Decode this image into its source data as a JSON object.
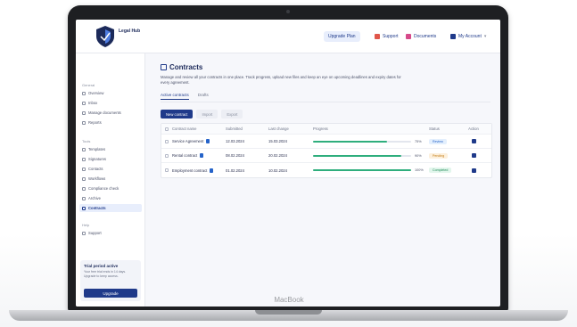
{
  "device": {
    "brand": "MacBook"
  },
  "app": {
    "logo_text": "Legal Hub"
  },
  "topbar": {
    "buttons": [
      {
        "label": "Upgrade Plan",
        "primary": true
      },
      {
        "label": "Support",
        "primary": false
      },
      {
        "label": "Documents",
        "primary": false
      },
      {
        "label": "My Account",
        "primary": false
      }
    ]
  },
  "sidebar": {
    "sections": [
      {
        "label": "General",
        "items": [
          {
            "label": "Overview",
            "active": false
          },
          {
            "label": "Inbox",
            "active": false
          },
          {
            "label": "Manage documents",
            "active": false
          },
          {
            "label": "Reports",
            "active": false
          }
        ]
      },
      {
        "label": "Tools",
        "items": [
          {
            "label": "Templates",
            "active": false
          },
          {
            "label": "Signatures",
            "active": false
          },
          {
            "label": "Contacts",
            "active": false
          },
          {
            "label": "Workflows",
            "active": false
          },
          {
            "label": "Compliance check",
            "active": false
          },
          {
            "label": "Archive",
            "active": false
          },
          {
            "label": "Contracts",
            "active": true
          }
        ]
      },
      {
        "label": "Help",
        "items": [
          {
            "label": "Support",
            "active": false
          }
        ]
      }
    ],
    "trial": {
      "title": "Trial period active",
      "subtitle": "Your free trial ends in 14 days. Upgrade to keep access.",
      "button": "Upgrade"
    }
  },
  "main": {
    "title": "Contracts",
    "description": "Manage and review all your contracts in one place. Track progress, upload new files and keep an eye on upcoming deadlines and expiry dates for every agreement.",
    "tabs": [
      {
        "label": "Active contracts",
        "active": true
      },
      {
        "label": "Drafts",
        "active": false
      }
    ],
    "actions": [
      {
        "label": "New contract",
        "primary": true
      },
      {
        "label": "Import",
        "primary": false
      },
      {
        "label": "Export",
        "primary": false
      }
    ],
    "table": {
      "headers": [
        "Contract name",
        "Submitted",
        "Last change",
        "Progress",
        "Status",
        "Action"
      ],
      "rows": [
        {
          "name": "Service Agreement",
          "submitted": "12.03.2024",
          "last": "15.03.2024",
          "progress": 0.75,
          "pct": "75%",
          "status": "Review",
          "status_color": "blue"
        },
        {
          "name": "Rental contract",
          "submitted": "08.02.2024",
          "last": "20.02.2024",
          "progress": 0.9,
          "pct": "90%",
          "status": "Pending",
          "status_color": "orange"
        },
        {
          "name": "Employment contract",
          "submitted": "01.02.2024",
          "last": "10.02.2024",
          "progress": 1.0,
          "pct": "100%",
          "status": "Completed",
          "status_color": "green"
        }
      ]
    }
  },
  "colors": {
    "accent": "#1f3a8a",
    "progress": "#2fae7d",
    "frame": "#1e1f22"
  }
}
